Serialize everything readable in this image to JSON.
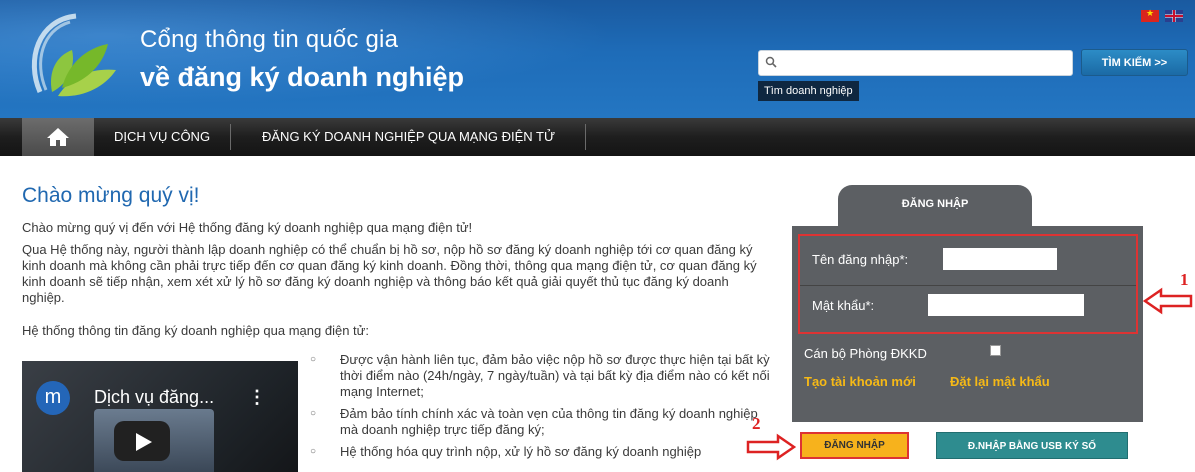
{
  "header": {
    "title_line1": "Cổng thông tin quốc gia",
    "title_line2": "về đăng ký doanh nghiệp",
    "search": {
      "placeholder": "",
      "button_label": "TÌM KIẾM >>",
      "hint": "Tìm doanh nghiệp"
    },
    "flags": [
      "vietnam-flag-icon",
      "uk-flag-icon"
    ]
  },
  "nav": {
    "items": [
      "DỊCH VỤ CÔNG",
      "ĐĂNG KÝ DOANH NGHIỆP QUA MẠNG ĐIỆN TỬ"
    ]
  },
  "main": {
    "title": "Chào mừng quý vị!",
    "paragraphs": [
      "Chào mừng quý vị đến với Hệ thống đăng ký doanh nghiệp qua mạng điện tử!",
      "Qua Hệ thống này, người thành lập doanh nghiệp có thể chuẩn bị hồ sơ, nộp hồ sơ đăng ký doanh nghiệp tới cơ quan đăng ký kinh doanh mà không cần phải trực tiếp đến cơ quan đăng ký kinh doanh. Đồng thời, thông qua mạng điện tử, cơ quan đăng ký kinh doanh sẽ tiếp nhận, xem xét xử lý hồ sơ đăng ký doanh nghiệp và thông báo kết quả giải quyết thủ tục đăng ký doanh nghiệp.",
      "Hệ thống thông tin đăng ký doanh nghiệp qua mạng điện tử:"
    ],
    "video": {
      "channel_initial": "m",
      "title": "Dịch vụ đăng..."
    },
    "bullets": [
      "Được vận hành liên tục, đảm bảo việc nộp hồ sơ được thực hiện tại bất kỳ thời điểm nào (24h/ngày, 7 ngày/tuần) và tại bất kỳ địa điểm nào có kết nối mạng Internet;",
      "Đảm bảo tính chính xác và toàn vẹn của thông tin đăng ký doanh nghiệp mà doanh nghiệp trực tiếp đăng ký;",
      "Hệ thống hóa quy trình nộp, xử lý hồ sơ đăng ký doanh nghiệp"
    ]
  },
  "login": {
    "tab_label": "ĐĂNG NHẬP",
    "username_label": "Tên đăng nhập*:",
    "password_label": "Mật khẩu*:",
    "officer_label": "Cán bộ Phòng ĐKKD",
    "create_account": "Tạo tài khoản mới",
    "reset_password": "Đặt lại mật khẩu",
    "login_button": "ĐĂNG NHẬP",
    "usb_button": "Đ.NHẬP BẰNG USB KÝ SỐ"
  },
  "annotations": {
    "marker_1": "1",
    "marker_2": "2"
  },
  "colors": {
    "accent_red": "#dd3333",
    "link_yellow": "#f6b916",
    "header_blue": "#1e6cb8"
  }
}
